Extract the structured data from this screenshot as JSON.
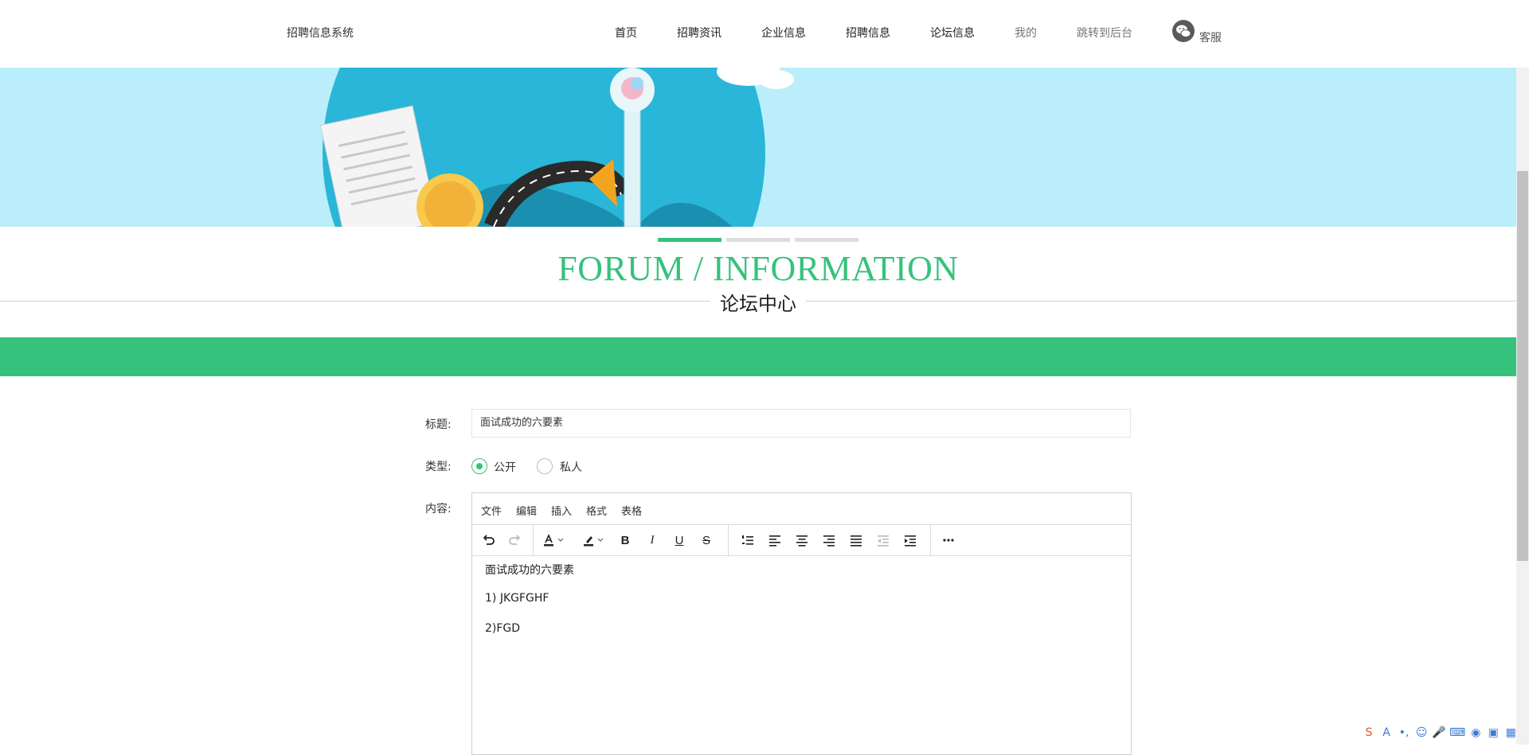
{
  "header": {
    "brand": "招聘信息系统",
    "nav": [
      "首页",
      "招聘资讯",
      "企业信息",
      "招聘信息",
      "论坛信息",
      "我的",
      "跳转到后台"
    ],
    "service_label": "客服"
  },
  "section": {
    "title_en": "FORUM / INFORMATION",
    "title_zh": "论坛中心"
  },
  "form": {
    "title_label": "标题:",
    "title_value": "面试成功的六要素",
    "type_label": "类型:",
    "type_options": [
      "公开",
      "私人"
    ],
    "type_selected": "公开",
    "content_label": "内容:"
  },
  "editor": {
    "menu": [
      "文件",
      "编辑",
      "插入",
      "格式",
      "表格"
    ],
    "toolbar_icons": [
      "undo-icon",
      "redo-icon",
      "text-color-icon",
      "highlight-icon",
      "bold-icon",
      "italic-icon",
      "underline-icon",
      "strikethrough-icon",
      "numbered-list-icon",
      "align-left-icon",
      "align-center-icon",
      "align-right-icon",
      "align-justify-icon",
      "outdent-icon",
      "indent-icon",
      "more-icon"
    ],
    "lines": [
      "面试成功的六要素",
      "1) JKGFGHF",
      "2)FGD"
    ]
  },
  "colors": {
    "accent": "#36c27c",
    "banner_bg": "#baeefa"
  },
  "slider": {
    "count": 3,
    "active": 0
  }
}
